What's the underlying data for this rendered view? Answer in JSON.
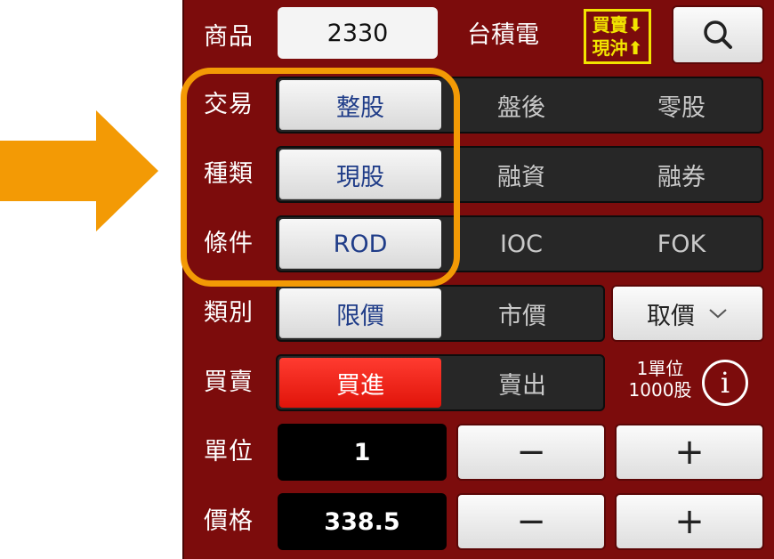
{
  "colors": {
    "panel": "#7c0c0c",
    "accent_arrow": "#f39a05",
    "active_text": "#1f3c88",
    "buy_red": "#ff3b30",
    "badge_yellow": "#f2e500"
  },
  "product": {
    "label": "商品",
    "code": "2330",
    "name": "台積電",
    "swap_line1": "買賣",
    "swap_line2": "現沖",
    "search_icon": "search-icon"
  },
  "trade": {
    "label": "交易",
    "options": [
      "整股",
      "盤後",
      "零股"
    ],
    "selected": "整股"
  },
  "kind": {
    "label": "種類",
    "options": [
      "現股",
      "融資",
      "融券"
    ],
    "selected": "現股"
  },
  "condition": {
    "label": "條件",
    "options": [
      "ROD",
      "IOC",
      "FOK"
    ],
    "selected": "ROD"
  },
  "category": {
    "label": "類別",
    "options": [
      "限價",
      "市價"
    ],
    "selected": "限價",
    "price_select": "取價"
  },
  "side": {
    "label": "買賣",
    "options": [
      "買進",
      "賣出"
    ],
    "selected": "買進",
    "unit_line1": "1單位",
    "unit_line2": "1000股"
  },
  "unit": {
    "label": "單位",
    "value": "1",
    "minus": "−",
    "plus": "+"
  },
  "price": {
    "label": "價格",
    "value": "338.5",
    "minus": "−",
    "plus": "+"
  }
}
